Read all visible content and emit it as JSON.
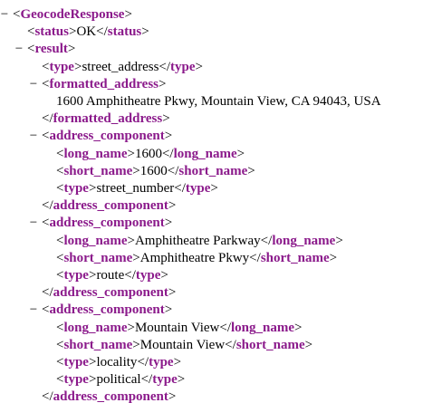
{
  "indent_symbol": "−",
  "lines": [
    {
      "kind": "open",
      "depth": 0,
      "toggle": true,
      "tag": "GeocodeResponse"
    },
    {
      "kind": "leaf",
      "depth": 1,
      "toggle": false,
      "tag": "status",
      "text": "OK"
    },
    {
      "kind": "open",
      "depth": 1,
      "toggle": true,
      "tag": "result"
    },
    {
      "kind": "leaf",
      "depth": 2,
      "toggle": false,
      "tag": "type",
      "text": "street_address"
    },
    {
      "kind": "open",
      "depth": 2,
      "toggle": true,
      "tag": "formatted_address"
    },
    {
      "kind": "text",
      "depth": 3,
      "toggle": false,
      "text": "1600 Amphitheatre Pkwy, Mountain View, CA 94043, USA"
    },
    {
      "kind": "close",
      "depth": 2,
      "toggle": false,
      "tag": "formatted_address"
    },
    {
      "kind": "open",
      "depth": 2,
      "toggle": true,
      "tag": "address_component"
    },
    {
      "kind": "leaf",
      "depth": 3,
      "toggle": false,
      "tag": "long_name",
      "text": "1600"
    },
    {
      "kind": "leaf",
      "depth": 3,
      "toggle": false,
      "tag": "short_name",
      "text": "1600"
    },
    {
      "kind": "leaf",
      "depth": 3,
      "toggle": false,
      "tag": "type",
      "text": "street_number"
    },
    {
      "kind": "close",
      "depth": 2,
      "toggle": false,
      "tag": "address_component"
    },
    {
      "kind": "open",
      "depth": 2,
      "toggle": true,
      "tag": "address_component"
    },
    {
      "kind": "leaf",
      "depth": 3,
      "toggle": false,
      "tag": "long_name",
      "text": "Amphitheatre Parkway"
    },
    {
      "kind": "leaf",
      "depth": 3,
      "toggle": false,
      "tag": "short_name",
      "text": "Amphitheatre Pkwy"
    },
    {
      "kind": "leaf",
      "depth": 3,
      "toggle": false,
      "tag": "type",
      "text": "route"
    },
    {
      "kind": "close",
      "depth": 2,
      "toggle": false,
      "tag": "address_component"
    },
    {
      "kind": "open",
      "depth": 2,
      "toggle": true,
      "tag": "address_component"
    },
    {
      "kind": "leaf",
      "depth": 3,
      "toggle": false,
      "tag": "long_name",
      "text": "Mountain View"
    },
    {
      "kind": "leaf",
      "depth": 3,
      "toggle": false,
      "tag": "short_name",
      "text": "Mountain View"
    },
    {
      "kind": "leaf",
      "depth": 3,
      "toggle": false,
      "tag": "type",
      "text": "locality"
    },
    {
      "kind": "leaf",
      "depth": 3,
      "toggle": false,
      "tag": "type",
      "text": "political"
    },
    {
      "kind": "close",
      "depth": 2,
      "toggle": false,
      "tag": "address_component"
    }
  ]
}
